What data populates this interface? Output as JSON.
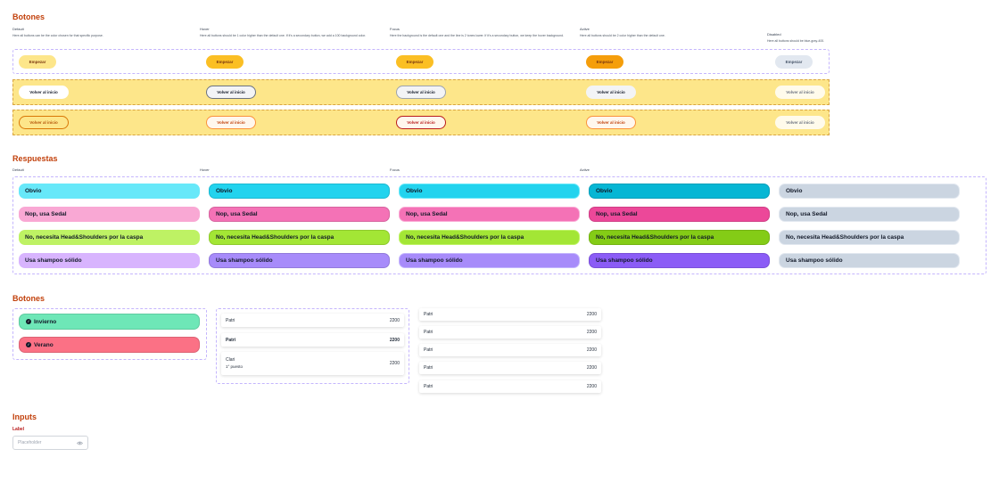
{
  "buttons_section": {
    "title": "Botones",
    "states": [
      {
        "name": "Default",
        "desc": "Here all buttons can be the color chosen for that specific purpose."
      },
      {
        "name": "Hover",
        "desc": "Here all buttons should be 1 color higher than the default one. If it's a secondary button, we add a 100 background color."
      },
      {
        "name": "Focus",
        "desc": "Here the background is the default one and the line is 2 tones lower. If it's a secondary button, we keep the hover background."
      },
      {
        "name": "Active",
        "desc": "Here all buttons should be 2 color higher than the default one."
      },
      {
        "name": "Disabled",
        "desc": "Here all buttons should be blue-gray-400."
      }
    ],
    "primary_label": "Empezar",
    "secondary_label": "Volver al inicio"
  },
  "responses_section": {
    "title": "Respuestas",
    "states": [
      "Default",
      "Hover",
      "Focus",
      "Active"
    ],
    "answers": [
      "Obvio",
      "Nop, usa Sedal",
      "No, necesita Head&Shoulders por la caspa",
      "Usa shampoo sólido"
    ]
  },
  "buttons2_section": {
    "title": "Botones",
    "toggles": [
      {
        "label": "Invierno",
        "color": "#6ee7b7"
      },
      {
        "label": "Verano",
        "color": "#fb7185"
      }
    ],
    "ranking_card": {
      "rows": [
        {
          "name": "Patri",
          "score": "2200",
          "bold": false
        },
        {
          "name": "Patri",
          "score": "2200",
          "bold": true
        },
        {
          "name": "Clari",
          "sub": "1° puesto",
          "score": "2200",
          "bold": false
        }
      ]
    },
    "ranking_list": [
      {
        "name": "Patri",
        "score": "2200"
      },
      {
        "name": "Patri",
        "score": "2200"
      },
      {
        "name": "Patri",
        "score": "2200"
      },
      {
        "name": "Patri",
        "score": "2200"
      },
      {
        "name": "Patri",
        "score": "2200"
      }
    ]
  },
  "inputs_section": {
    "title": "Inputs",
    "label": "Label",
    "placeholder": "Placeholder",
    "eye_icon": "eye-icon"
  }
}
